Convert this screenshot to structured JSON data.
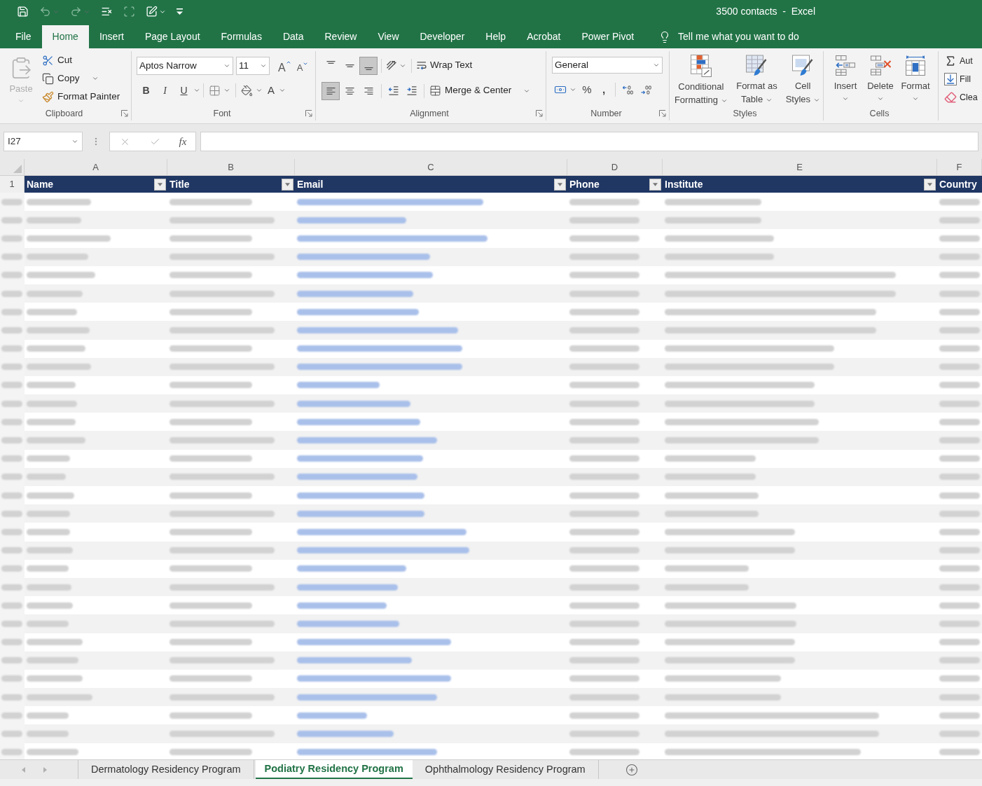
{
  "window": {
    "title": "3500 contacts  -  Excel"
  },
  "quick_access": [
    {
      "kind": "save",
      "disabled": false
    },
    {
      "kind": "undo",
      "disabled": true
    },
    {
      "kind": "redo",
      "disabled": true
    },
    {
      "kind": "clear",
      "disabled": false
    },
    {
      "kind": "frame",
      "disabled": true
    },
    {
      "kind": "form",
      "disabled": false
    },
    {
      "kind": "customize",
      "disabled": false
    }
  ],
  "menu_tabs": [
    {
      "label": "File",
      "selected": false
    },
    {
      "label": "Home",
      "selected": true
    },
    {
      "label": "Insert",
      "selected": false
    },
    {
      "label": "Page Layout",
      "selected": false
    },
    {
      "label": "Formulas",
      "selected": false
    },
    {
      "label": "Data",
      "selected": false
    },
    {
      "label": "Review",
      "selected": false
    },
    {
      "label": "View",
      "selected": false
    },
    {
      "label": "Developer",
      "selected": false
    },
    {
      "label": "Help",
      "selected": false
    },
    {
      "label": "Acrobat",
      "selected": false
    },
    {
      "label": "Power Pivot",
      "selected": false
    }
  ],
  "tell_me": {
    "placeholder": "Tell me what you want to do"
  },
  "ribbon": {
    "clipboard": {
      "label": "Clipboard",
      "paste": {
        "label": "Paste",
        "disabled": true
      },
      "buttons": [
        {
          "kind": "cut",
          "label": "Cut"
        },
        {
          "kind": "copy",
          "label": "Copy"
        },
        {
          "kind": "format_painter",
          "label": "Format Painter"
        }
      ]
    },
    "font": {
      "label": "Font",
      "font_name": "Aptos Narrow",
      "font_size": "11",
      "grow": "A",
      "shrink": "A",
      "styles": [
        {
          "kind": "bold",
          "label": "B",
          "on": false
        },
        {
          "kind": "italic",
          "label": "I",
          "on": false
        },
        {
          "kind": "underline",
          "label": "U",
          "on": false
        }
      ],
      "font_color": "A"
    },
    "alignment": {
      "label": "Alignment",
      "vertical": [
        {
          "kind": "top",
          "selected": false
        },
        {
          "kind": "middle",
          "selected": false
        },
        {
          "kind": "bottom",
          "selected": true
        }
      ],
      "horizontal": [
        {
          "kind": "left",
          "selected": true
        },
        {
          "kind": "center",
          "selected": false
        },
        {
          "kind": "right",
          "selected": false
        }
      ],
      "wrap_text": "Wrap Text",
      "merge": "Merge & Center"
    },
    "number": {
      "label": "Number",
      "format": "General",
      "percent": "%",
      "comma": ","
    },
    "styles": {
      "label": "Styles",
      "buttons": [
        {
          "kind": "conditional",
          "label": "Conditional Formatting"
        },
        {
          "kind": "table",
          "label": "Format as Table"
        },
        {
          "kind": "cell",
          "label": "Cell Styles"
        }
      ]
    },
    "cells": {
      "label": "Cells",
      "buttons": [
        {
          "kind": "insert",
          "label": "Insert"
        },
        {
          "kind": "delete",
          "label": "Delete"
        },
        {
          "kind": "format",
          "label": "Format"
        }
      ]
    },
    "editing": {
      "buttons": [
        {
          "kind": "autosum",
          "label": "Aut"
        },
        {
          "kind": "fill",
          "label": "Fill"
        },
        {
          "kind": "clear",
          "label": "Clea"
        }
      ]
    }
  },
  "formula_bar": {
    "name_box": "I27",
    "function_button": "fx"
  },
  "sheet": {
    "header_row_number": "1",
    "columns": [
      {
        "letter": "A",
        "header": "Name",
        "filter_button": true
      },
      {
        "letter": "B",
        "header": "Title",
        "filter_button": true
      },
      {
        "letter": "C",
        "header": "Email",
        "filter_button": true
      },
      {
        "letter": "D",
        "header": "Phone",
        "filter_button": true
      },
      {
        "letter": "E",
        "header": "Institute",
        "filter_button": true
      },
      {
        "letter": "F",
        "header": "Country",
        "filter_button": false
      }
    ],
    "rows": [
      {
        "banded": false
      },
      {
        "banded": true
      },
      {
        "banded": false
      },
      {
        "banded": true
      },
      {
        "banded": false
      },
      {
        "banded": true
      },
      {
        "banded": false
      },
      {
        "banded": true
      },
      {
        "banded": false
      },
      {
        "banded": true
      },
      {
        "banded": false
      },
      {
        "banded": true
      },
      {
        "banded": false
      },
      {
        "banded": true
      },
      {
        "banded": false
      },
      {
        "banded": true
      },
      {
        "banded": false
      },
      {
        "banded": true
      },
      {
        "banded": false
      },
      {
        "banded": true
      },
      {
        "banded": false
      },
      {
        "banded": true
      },
      {
        "banded": false
      },
      {
        "banded": true
      },
      {
        "banded": false
      },
      {
        "banded": true
      },
      {
        "banded": false
      },
      {
        "banded": true
      },
      {
        "banded": false
      },
      {
        "banded": true
      },
      {
        "banded": false
      }
    ]
  },
  "sheet_tabs": [
    {
      "label": "Dermatology Residency Program",
      "selected": false
    },
    {
      "label": "Podiatry Residency Program",
      "selected": true
    },
    {
      "label": "Ophthalmology Residency Program",
      "selected": false
    }
  ]
}
